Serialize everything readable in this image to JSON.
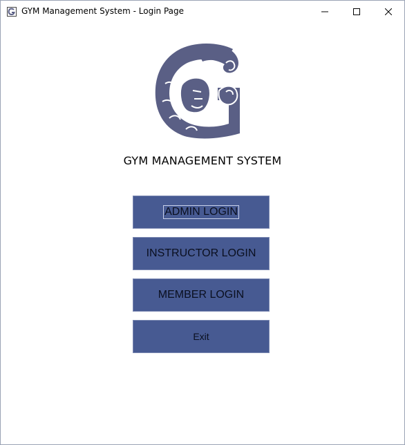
{
  "window": {
    "title": "GYM Management System - Login Page",
    "icons": [
      "app-icon",
      "minimize-icon",
      "maximize-icon",
      "close-icon"
    ]
  },
  "brand": {
    "logo": "flexing-arm-g-logo-icon",
    "heading": "GYM MANAGEMENT SYSTEM",
    "logo_color": "#5a5f85"
  },
  "buttons": {
    "admin": "ADMIN LOGIN",
    "instructor": "INSTRUCTOR LOGIN",
    "member": "MEMBER LOGIN",
    "exit": "Exit"
  },
  "colors": {
    "button_bg": "#475a92",
    "button_text": "#0a0f1f"
  }
}
